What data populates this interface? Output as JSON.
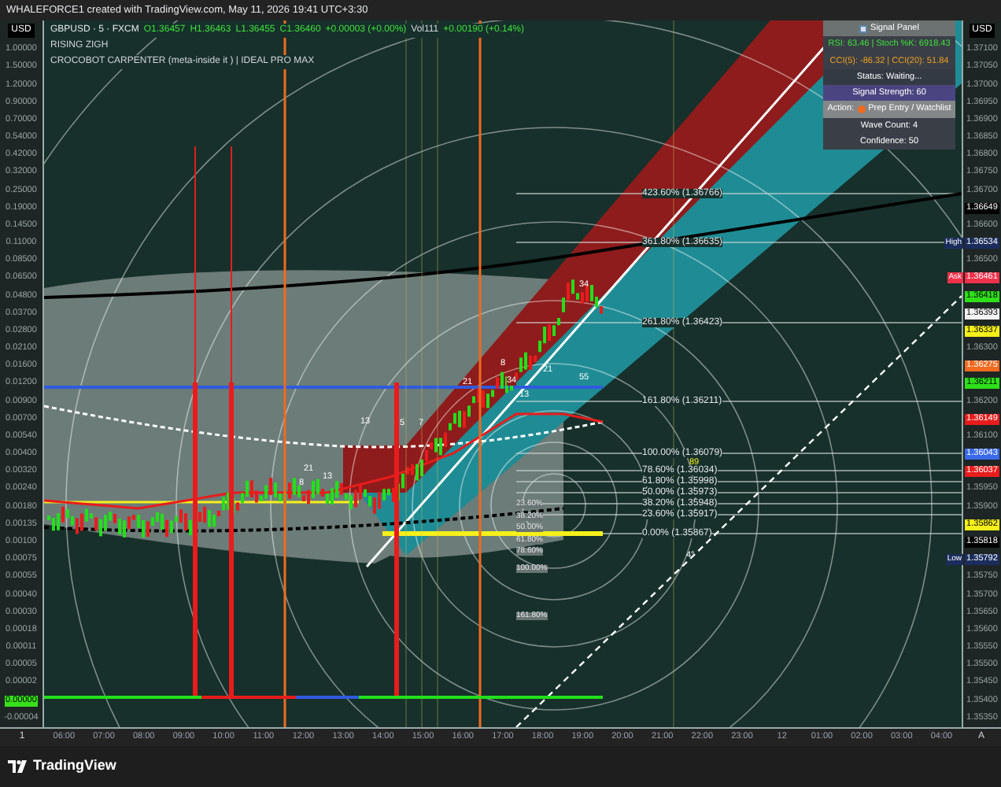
{
  "header": {
    "title": "WHALEFORCE1 created with TradingView.com, May 11, 2026 19:41 UTC+3:30"
  },
  "legend": {
    "symbol": "GBPUSD · 5 · FXCM",
    "ohlc": [
      "O1.36457",
      "H1.36463",
      "L1.36455",
      "C1.36460",
      "+0.00003 (+0.00%)"
    ],
    "volume": "Vol111",
    "change": "+0.00190 (+0.14%)",
    "lines": [
      "RISING ZIGH",
      "CROCOBOT CARPENTER (meta-inside it ) | IDEAL PRO MAX"
    ]
  },
  "left_axis": {
    "currency": "USD",
    "ticks": [
      {
        "text": "1.00000"
      },
      {
        "text": "1.50000"
      },
      {
        "text": "1.20000"
      },
      {
        "text": "0.90000"
      },
      {
        "text": "0.70000"
      },
      {
        "text": "0.54000"
      },
      {
        "text": "0.42000"
      },
      {
        "text": "0.32000"
      },
      {
        "text": "0.25000"
      },
      {
        "text": "0.19000"
      },
      {
        "text": "0.14500"
      },
      {
        "text": "0.11000"
      },
      {
        "text": "0.08500"
      },
      {
        "text": "0.06500"
      },
      {
        "text": "0.04800"
      },
      {
        "text": "0.03700"
      },
      {
        "text": "0.02800"
      },
      {
        "text": "0.02100"
      },
      {
        "text": "0.01600"
      },
      {
        "text": "0.01200"
      },
      {
        "text": "0.00900"
      },
      {
        "text": "0.00700"
      },
      {
        "text": "0.00540"
      },
      {
        "text": "0.00400"
      },
      {
        "text": "0.00320"
      },
      {
        "text": "0.00240"
      },
      {
        "text": "0.00180"
      },
      {
        "text": "0.00135"
      },
      {
        "text": "0.00100"
      },
      {
        "text": "0.00075"
      },
      {
        "text": "0.00055"
      },
      {
        "text": "0.00040"
      },
      {
        "text": "0.00030"
      },
      {
        "text": "0.00018"
      },
      {
        "text": "0.00011"
      },
      {
        "text": "0.00005"
      },
      {
        "text": "0.00002"
      },
      {
        "text": "0.00000",
        "color": "#38e01a"
      },
      {
        "text": "-0.00004"
      }
    ]
  },
  "right_axis": {
    "currency": "USD",
    "ticks": [
      {
        "text": "1.37100"
      },
      {
        "text": "1.37050"
      },
      {
        "text": "1.37000"
      },
      {
        "text": "1.36950"
      },
      {
        "text": "1.36900"
      },
      {
        "text": "1.36850"
      },
      {
        "text": "1.36800"
      },
      {
        "text": "1.36750"
      },
      {
        "text": "1.36700"
      },
      {
        "text": "1.36649",
        "color": "#000000"
      },
      {
        "text": "1.36600"
      },
      {
        "text": "1.36534",
        "color": "#1b2d5c",
        "side_label": "High"
      },
      {
        "text": "1.36500"
      },
      {
        "text": "1.36461",
        "color": "#f0314a",
        "side_label": "Ask"
      },
      {
        "text": "1.36418",
        "color": "#2ee01a"
      },
      {
        "text": "1.36393",
        "color": "#f4f4f4"
      },
      {
        "text": "1.36337",
        "color": "#f5f01a"
      },
      {
        "text": "1.36300"
      },
      {
        "text": "1.36275",
        "color": "#f06a20"
      },
      {
        "text": "1.36211",
        "color": "#2ee01a"
      },
      {
        "text": "1.36200"
      },
      {
        "text": "1.36149",
        "color": "#e81c1c"
      },
      {
        "text": "1.36100"
      },
      {
        "text": "1.36043",
        "color": "#3a6ae8"
      },
      {
        "text": "1.36037",
        "color": "#e81c1c"
      },
      {
        "text": "1.35950"
      },
      {
        "text": "1.35900"
      },
      {
        "text": "1.35862",
        "color": "#f5f01a"
      },
      {
        "text": "1.35818",
        "color": "#000000"
      },
      {
        "text": "1.35792",
        "color": "#1b2d5c",
        "side_label": "Low"
      },
      {
        "text": "1.35750"
      },
      {
        "text": "1.35700"
      },
      {
        "text": "1.35650"
      },
      {
        "text": "1.35600"
      },
      {
        "text": "1.35550"
      },
      {
        "text": "1.35500"
      },
      {
        "text": "1.35450"
      },
      {
        "text": "1.35400"
      },
      {
        "text": "1.35350"
      }
    ]
  },
  "fib_labels": [
    "423.60% (1.36766)",
    "361.80% (1.36635)",
    "261.80% (1.36423)",
    "161.80% (1.36211)",
    "100.00% (1.36079)",
    "78.60% (1.36034)",
    "61.80% (1.35998)",
    "50.00% (1.35973)",
    "38.20% (1.35948)",
    "23.60% (1.35917)",
    "0.00% (1.35867)"
  ],
  "circle_labels": [
    "23.60%",
    "38.20%",
    "50.00%",
    "61.80%",
    "78.60%",
    "100.00%",
    "161.80%"
  ],
  "wave_labels": [
    "34",
    "8",
    "21",
    "34",
    "21",
    "13",
    "55",
    "21",
    "13",
    "8",
    "13",
    "5",
    "7",
    "89",
    "4°"
  ],
  "signal_panel": {
    "title": "Signal Panel",
    "rsi_line": "RSI: 63.46 | Stoch %K: 6918.43",
    "cci_line": "CCI(5): -86.32 | CCI(20): 51.84",
    "status": "Status: Waiting...",
    "strength": "Signal Strength: 60",
    "action_label": "Action:",
    "action": "Prep Entry / Watchlist",
    "action_dot": {
      "color": "#f06a20"
    },
    "wave_count": "Wave Count: 4",
    "confidence": "Confidence: 50"
  },
  "time_axis": {
    "left_button": "1",
    "ticks": [
      "06:00",
      "07:00",
      "08:00",
      "09:00",
      "10:00",
      "11:00",
      "12:00",
      "13:00",
      "14:00",
      "15:00",
      "16:00",
      "17:00",
      "18:00",
      "19:00",
      "20:00",
      "21:00",
      "22:00",
      "23:00",
      "12",
      "01:00",
      "02:00",
      "03:00",
      "04:00"
    ],
    "right_button": "A"
  },
  "footer": {
    "brand": "TradingView"
  }
}
